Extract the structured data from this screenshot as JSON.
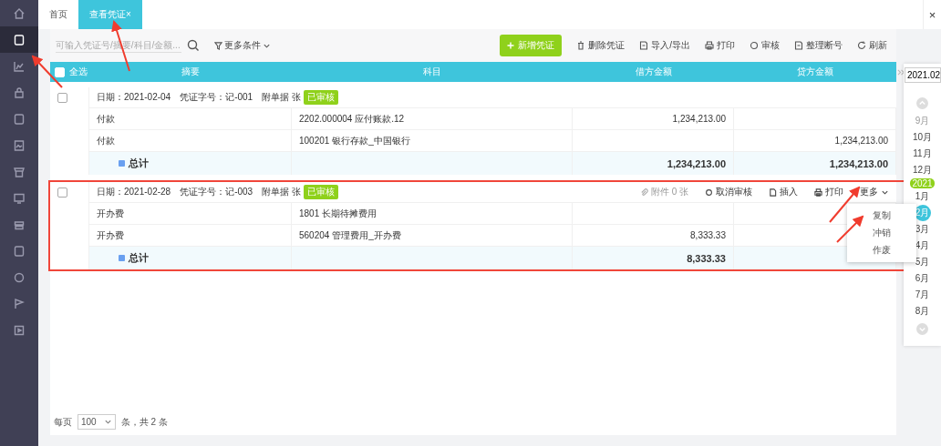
{
  "sidebar": {
    "items": [
      {
        "selected": false
      },
      {
        "selected": true
      },
      {
        "selected": false
      },
      {
        "selected": false
      },
      {
        "selected": false
      },
      {
        "selected": false
      },
      {
        "selected": false
      },
      {
        "selected": false
      },
      {
        "selected": false
      },
      {
        "selected": false
      },
      {
        "selected": false
      },
      {
        "selected": false
      },
      {
        "selected": false
      }
    ]
  },
  "tabs": [
    {
      "label": "首页",
      "selected": false
    },
    {
      "label": "查看凭证",
      "selected": true,
      "close": "×"
    }
  ],
  "window": {
    "close": "×"
  },
  "toolbar": {
    "search": {
      "placeholder": "可输入凭证号/摘要/科目/金额..."
    },
    "filter": "更多条件",
    "buttons": [
      {
        "label": "新增凭证",
        "kind": "primary"
      },
      {
        "label": "删除凭证",
        "kind": "delete"
      },
      {
        "label": "导入/导出",
        "kind": "import"
      },
      {
        "label": "打印",
        "kind": "print"
      },
      {
        "label": "审核",
        "kind": "audit"
      },
      {
        "label": "整理断号",
        "kind": "renumber"
      },
      {
        "label": "刷新",
        "kind": "refresh"
      }
    ]
  },
  "table": {
    "select_all": {
      "label": "全选",
      "checked": false
    },
    "columns": [
      "摘要",
      "科目",
      "借方金额",
      "贷方金额"
    ]
  },
  "vouchers": [
    {
      "checked": false,
      "highlighted": false,
      "date": "日期：2021-02-04",
      "number": "凭证字号：记-001",
      "attachments": "附单据  张",
      "status": "已审核",
      "rows": [
        {
          "summary": "付款",
          "account": "2202.000004  应付账款.12",
          "debit": "1,234,213.00"
        },
        {
          "summary": "付款",
          "account": "100201 银行存款_中国银行",
          "credit": "1,234,213.00"
        }
      ],
      "total_label": "总计",
      "total_debit": "1,234,213.00",
      "total_credit": "1,234,213.00"
    },
    {
      "checked": false,
      "highlighted": true,
      "date": "日期：2021-02-28",
      "number": "凭证字号：记-003",
      "attachments": "附单据  张",
      "status": "已审核",
      "actions": [
        {
          "label": "附件 0 张",
          "kind": "attach",
          "disabled": true
        },
        {
          "label": "取消审核",
          "kind": "unaudit",
          "disabled": false
        },
        {
          "label": "插入",
          "kind": "insert",
          "disabled": false
        },
        {
          "label": "打印",
          "kind": "print",
          "disabled": false
        },
        {
          "label": "更多",
          "kind": "more",
          "disabled": false,
          "expanded": true
        }
      ],
      "rows": [
        {
          "summary": "开办费",
          "account": "1801 长期待摊费用"
        },
        {
          "summary": "开办费",
          "account": "560204 管理费用_开办费",
          "debit": "8,333.33"
        }
      ],
      "total_label": "总计",
      "total_debit": "8,333.33"
    }
  ],
  "more_menu": {
    "items": [
      "复制",
      "冲销",
      "作废"
    ]
  },
  "calendar": {
    "field": "2021.02",
    "year_badge": "2021",
    "months": [
      {
        "label": "9月",
        "selected": false
      },
      {
        "label": "10月",
        "selected": false
      },
      {
        "label": "11月",
        "selected": false
      },
      {
        "label": "12月",
        "selected": false
      },
      {
        "label": "1月",
        "selected": false
      },
      {
        "label": "2月",
        "selected": true
      },
      {
        "label": "3月",
        "selected": false
      },
      {
        "label": "4月",
        "selected": false
      },
      {
        "label": "5月",
        "selected": false
      },
      {
        "label": "6月",
        "selected": false
      },
      {
        "label": "7月",
        "selected": false
      },
      {
        "label": "8月",
        "selected": false
      }
    ]
  },
  "pagination": {
    "label": "每页",
    "page_size": "100",
    "summary": "条，共 2 条"
  }
}
